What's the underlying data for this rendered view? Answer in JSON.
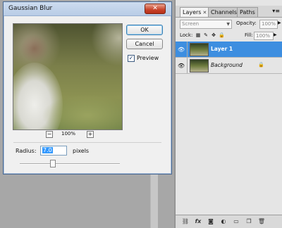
{
  "dialog": {
    "title": "Gaussian Blur",
    "ok_label": "OK",
    "cancel_label": "Cancel",
    "preview_label": "Preview",
    "preview_checked": true,
    "zoom_level": "100%",
    "zoom_out_label": "−",
    "zoom_in_label": "+",
    "radius_label": "Radius:",
    "radius_value": "7.0",
    "radius_unit": "pixels"
  },
  "layers_panel": {
    "tabs": [
      {
        "label": "Layers",
        "active": true
      },
      {
        "label": "Channels",
        "active": false
      },
      {
        "label": "Paths",
        "active": false
      }
    ],
    "blend_mode": "Screen",
    "opacity_label": "Opacity:",
    "opacity_value": "100%",
    "lock_label": "Lock:",
    "fill_label": "Fill:",
    "fill_value": "100%",
    "layers": [
      {
        "name": "Layer 1",
        "selected": true,
        "locked": false
      },
      {
        "name": "Background",
        "selected": false,
        "locked": true
      }
    ],
    "bottom_icons": [
      "link-icon",
      "fx-icon",
      "mask-icon",
      "adjustment-icon",
      "folder-icon",
      "new-layer-icon",
      "trash-icon"
    ]
  },
  "colors": {
    "selection_blue": "#3d8ee0",
    "close_button_red": "#c8432a"
  }
}
